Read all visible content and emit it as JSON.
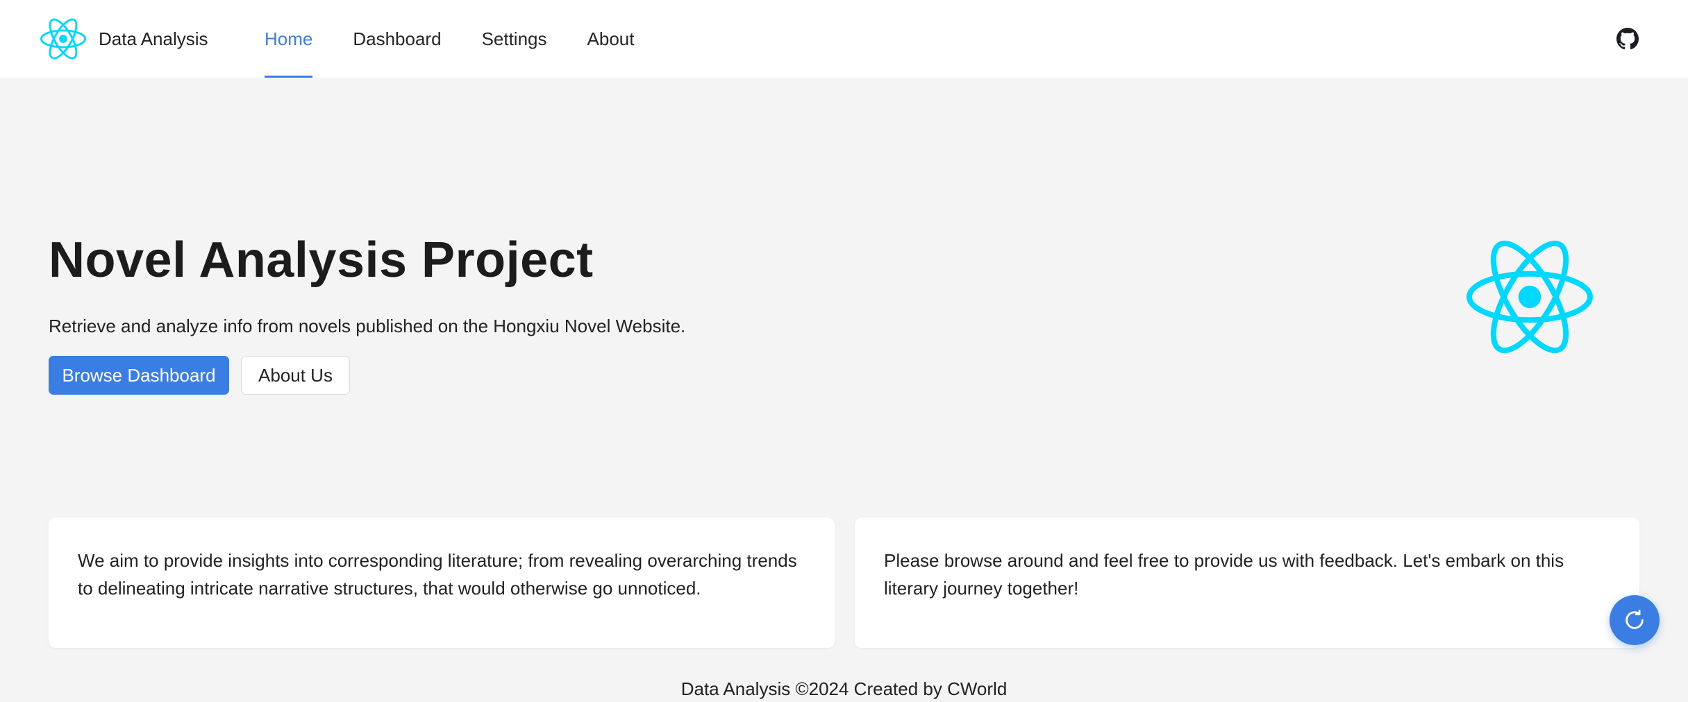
{
  "brand": {
    "name": "Data Analysis",
    "logo_icon": "react-atom-icon"
  },
  "nav": {
    "items": [
      {
        "label": "Home",
        "active": true
      },
      {
        "label": "Dashboard",
        "active": false
      },
      {
        "label": "Settings",
        "active": false
      },
      {
        "label": "About",
        "active": false
      }
    ]
  },
  "header": {
    "github_icon": "github-icon"
  },
  "hero": {
    "title": "Novel Analysis Project",
    "subtitle": "Retrieve and analyze info from novels published on the Hongxiu Novel Website.",
    "primary_button": "Browse Dashboard",
    "secondary_button": "About Us",
    "logo_icon": "react-atom-icon"
  },
  "cards": [
    {
      "text": "We aim to provide insights into corresponding literature; from revealing overarching trends to delineating intricate narrative structures, that would otherwise go unnoticed."
    },
    {
      "text": "Please browse around and feel free to provide us with feedback. Let's embark on this literary journey together!"
    }
  ],
  "fab": {
    "icon": "refresh-icon"
  },
  "footer": {
    "text": "Data Analysis ©2024 Created by CWorld"
  },
  "colors": {
    "accent": "#3a7ee4",
    "react_cyan": "#00d8ff",
    "background": "#f4f4f4"
  }
}
